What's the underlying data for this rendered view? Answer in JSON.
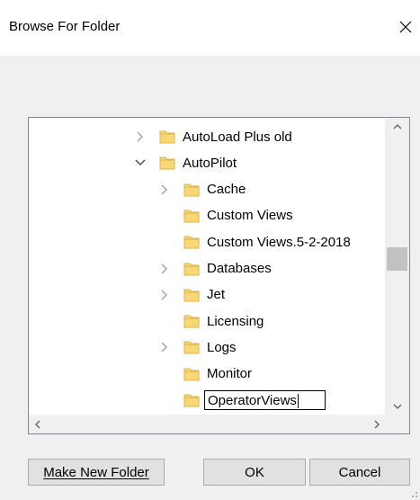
{
  "window": {
    "title": "Browse For Folder"
  },
  "tree": {
    "items": [
      {
        "label": "AutoLoad Plus old",
        "level": 0,
        "expander": "collapsed"
      },
      {
        "label": "AutoPilot",
        "level": 0,
        "expander": "expanded"
      },
      {
        "label": "Cache",
        "level": 1,
        "expander": "collapsed"
      },
      {
        "label": "Custom Views",
        "level": 1,
        "expander": "none"
      },
      {
        "label": "Custom Views.5-2-2018",
        "level": 1,
        "expander": "none"
      },
      {
        "label": "Databases",
        "level": 1,
        "expander": "collapsed"
      },
      {
        "label": "Jet",
        "level": 1,
        "expander": "collapsed"
      },
      {
        "label": "Licensing",
        "level": 1,
        "expander": "none"
      },
      {
        "label": "Logs",
        "level": 1,
        "expander": "collapsed"
      },
      {
        "label": "Monitor",
        "level": 1,
        "expander": "none"
      }
    ],
    "editing_item": {
      "value": "OperatorViews",
      "level": 1
    }
  },
  "buttons": {
    "make_new_folder": "Make New Folder",
    "ok": "OK",
    "cancel": "Cancel"
  },
  "colors": {
    "folder": "#f8d775",
    "folder_dark": "#e0b34c",
    "accent": "#0078d7"
  }
}
